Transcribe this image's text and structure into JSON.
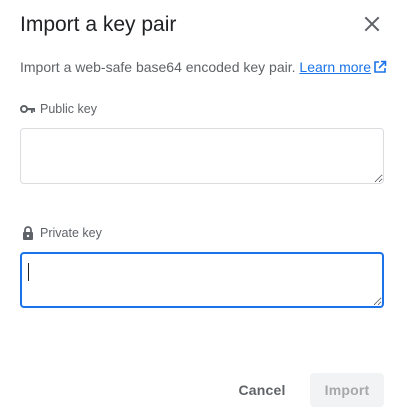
{
  "dialog": {
    "title": "Import a key pair",
    "description": "Import a web-safe base64 encoded key pair. ",
    "learn_more": "Learn more",
    "public_key": {
      "label": "Public key",
      "value": "",
      "icon": "key-icon"
    },
    "private_key": {
      "label": "Private key",
      "value": "",
      "icon": "lock-icon"
    },
    "buttons": {
      "cancel": "Cancel",
      "import": "Import"
    },
    "colors": {
      "accent": "#1a73e8",
      "text": "#202124",
      "muted": "#5f6368",
      "border": "#dadce0"
    }
  }
}
